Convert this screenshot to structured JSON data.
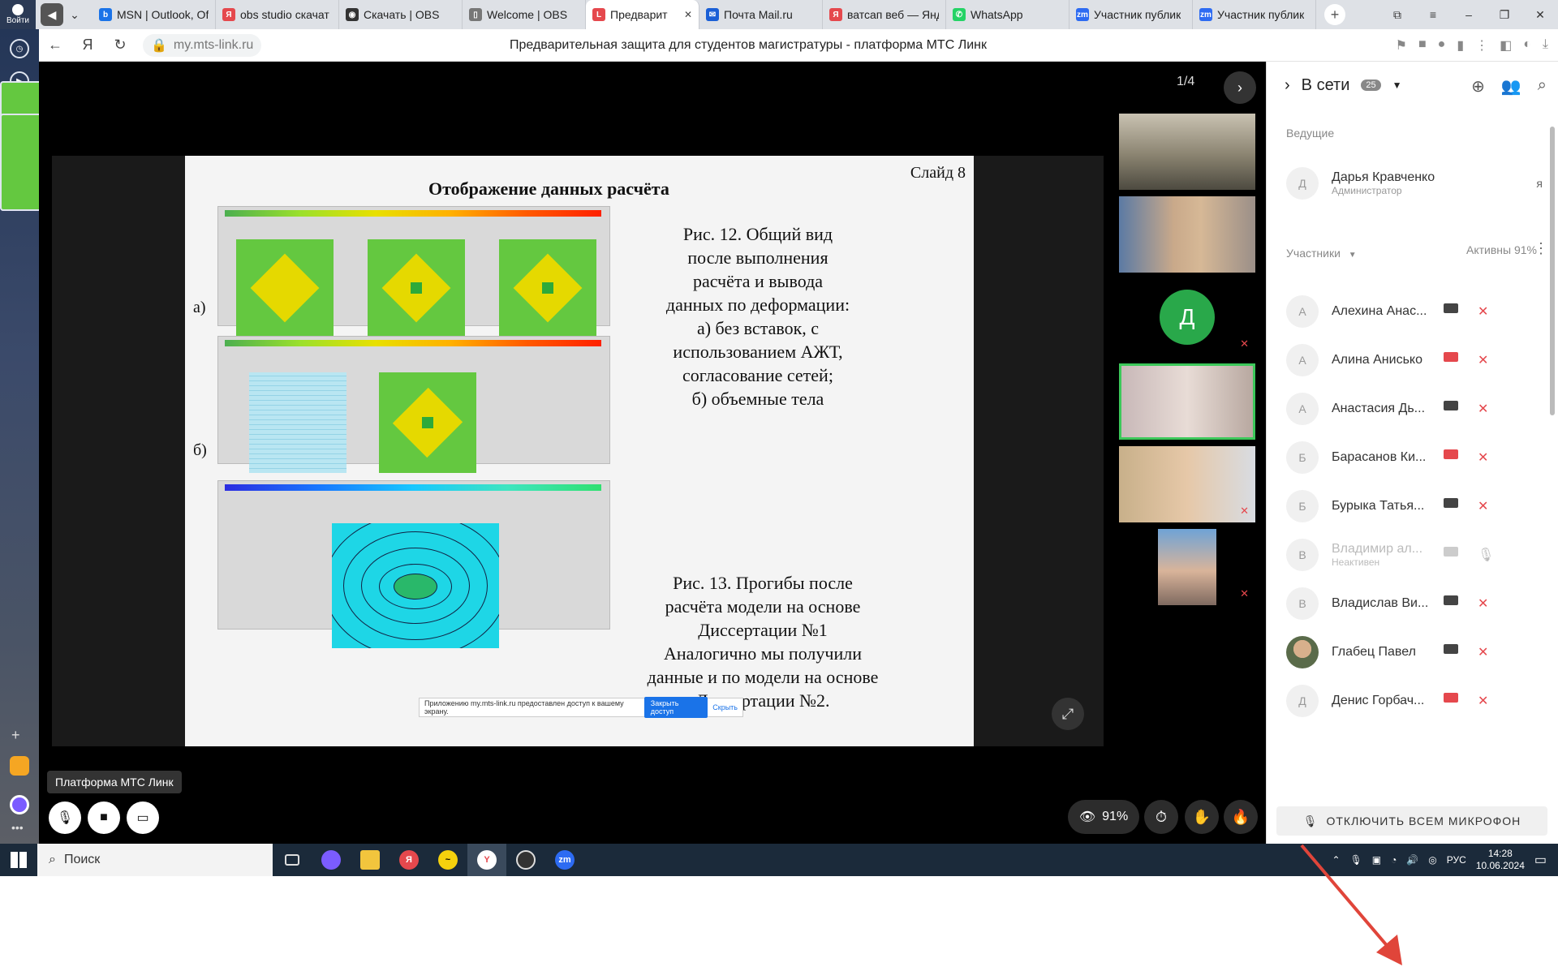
{
  "browser": {
    "user_label": "Войти",
    "tabs": [
      {
        "title": "MSN | Outlook, Of",
        "icon": "outlook-icon",
        "color": "#1a73e8",
        "glyph": "b"
      },
      {
        "title": "obs studio скачат",
        "icon": "yandex-icon",
        "color": "#e5484d",
        "glyph": "Я"
      },
      {
        "title": "Скачать | OBS",
        "icon": "obs-icon",
        "color": "#333333",
        "glyph": "◉"
      },
      {
        "title": "Welcome | OBS",
        "icon": "page-icon",
        "color": "#777777",
        "glyph": "▯"
      },
      {
        "title": "Предварит",
        "icon": "mts-link-icon",
        "color": "#e5484d",
        "glyph": "L",
        "active": true
      },
      {
        "title": "Почта Mail.ru",
        "icon": "mail-icon",
        "color": "#1a5fd6",
        "glyph": "✉"
      },
      {
        "title": "ватсап веб — Янд",
        "icon": "yandex-icon",
        "color": "#e5484d",
        "glyph": "Я"
      },
      {
        "title": "WhatsApp",
        "icon": "whatsapp-icon",
        "color": "#25d366",
        "glyph": "✆"
      },
      {
        "title": "Участник публик",
        "icon": "zoom-icon",
        "color": "#2d6bf2",
        "glyph": "zm"
      },
      {
        "title": "Участник публик",
        "icon": "zoom-icon",
        "color": "#2d6bf2",
        "glyph": "zm"
      }
    ],
    "url": "my.mts-link.ru",
    "page_title": "Предварительная защита для студентов магистратуры - платформа МТС Линк"
  },
  "slide": {
    "pager": "1/4",
    "number": "Слайд 8",
    "title": "Отображение данных расчёта",
    "label_a": "а)",
    "label_b": "б)",
    "caption_12": [
      "Рис. 12. Общий вид",
      "после выполнения",
      "расчёта и вывода",
      "данных по деформации:",
      "а) без вставок, с",
      "использованием АЖТ,",
      "согласование сетей;",
      "б) объемные тела"
    ],
    "caption_13": [
      "Рис. 13. Прогибы после",
      "расчёта модели на основе",
      "Диссертации №1",
      "Аналогично мы получили",
      "данные и по модели на основе",
      "Диссертации №2."
    ],
    "share_text": "Приложению my.mts-link.ru предоставлен доступ к вашему экрану.",
    "share_btn": "Закрыть доступ",
    "hide_btn": "Скрыть"
  },
  "controls": {
    "tooltip": "Платформа МТС Линк",
    "view_percent": "91%"
  },
  "participants_panel": {
    "header": "В сети",
    "count": "25",
    "hosts_label": "Ведущие",
    "host": {
      "initial": "Д",
      "name": "Дарья Кравченко",
      "role": "Администратор",
      "me": "я"
    },
    "participants_label": "Участники",
    "active_label": "Активны 91%",
    "list": [
      {
        "initial": "А",
        "name": "Алехина Анас...",
        "cam": "on",
        "mic": "muted"
      },
      {
        "initial": "А",
        "name": "Алина Анисько",
        "cam": "off",
        "mic": "muted"
      },
      {
        "initial": "А",
        "name": "Анастасия Дь...",
        "cam": "on",
        "mic": "muted"
      },
      {
        "initial": "Б",
        "name": "Барасанов Ки...",
        "cam": "off",
        "mic": "muted"
      },
      {
        "initial": "Б",
        "name": "Бурыка Татья...",
        "cam": "on",
        "mic": "muted"
      },
      {
        "initial": "В",
        "name": "Владимир ал...",
        "sub": "Неактивен",
        "cam": "dim",
        "mic": "dim"
      },
      {
        "initial": "В",
        "name": "Владислав Ви...",
        "cam": "on",
        "mic": "muted"
      },
      {
        "initial": "",
        "name": "Глабец Павел",
        "cam": "on",
        "mic": "muted",
        "photo": true
      },
      {
        "initial": "Д",
        "name": "Денис Горбач...",
        "cam": "off",
        "mic": "muted"
      }
    ],
    "mute_all": "ОТКЛЮЧИТЬ ВСЕМ МИКРОФОН"
  },
  "video_tile_initial": "Д",
  "taskbar": {
    "search_label": "Поиск",
    "language": "РУС",
    "time": "14:28",
    "date": "10.06.2024"
  }
}
